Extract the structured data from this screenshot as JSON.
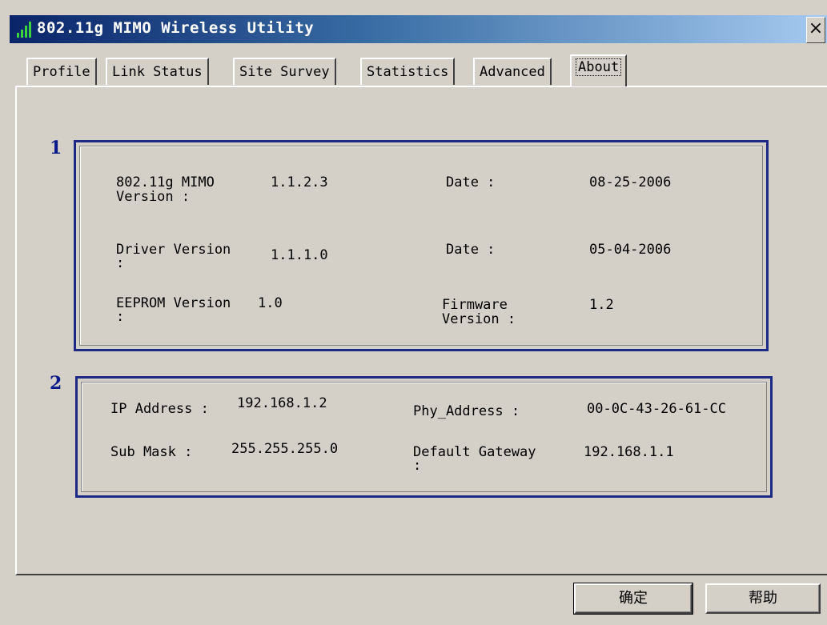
{
  "window": {
    "title": "802.11g MIMO Wireless Utility",
    "close_glyph": "×"
  },
  "tabs": [
    {
      "label": "Profile"
    },
    {
      "label": "Link Status"
    },
    {
      "label": "Site Survey"
    },
    {
      "label": "Statistics"
    },
    {
      "label": "Advanced"
    },
    {
      "label": "About",
      "active": true
    }
  ],
  "group1": {
    "number": "1",
    "utility_version_label": "802.11g MIMO\nVersion :",
    "utility_version": "1.1.2.3",
    "utility_date_label": "Date :",
    "utility_date": "08-25-2006",
    "driver_version_label": "Driver Version",
    "driver_colon": ":",
    "driver_version": "1.1.1.0",
    "driver_date_label": "Date :",
    "driver_date": "05-04-2006",
    "eeprom_version_label": "EEPROM Version",
    "eeprom_colon": ":",
    "eeprom_version": "1.0",
    "firmware_version_label": "Firmware\nVersion :",
    "firmware_version": "1.2"
  },
  "group2": {
    "number": "2",
    "ip_label": "IP Address :",
    "ip_value": "192.168.1.2",
    "phy_label": "Phy_Address :",
    "phy_value": "00-0C-43-26-61-CC",
    "mask_label": "Sub Mask :",
    "mask_value": "255.255.255.0",
    "gateway_label": "Default Gateway",
    "gateway_colon": ":",
    "gateway_value": "192.168.1.1"
  },
  "buttons": {
    "ok": "确定",
    "help": "帮助"
  },
  "colors": {
    "titlebar_start": "#0a246a",
    "titlebar_end": "#a6caf0",
    "group_border": "#1c2a85",
    "face": "#d4d0c8"
  }
}
